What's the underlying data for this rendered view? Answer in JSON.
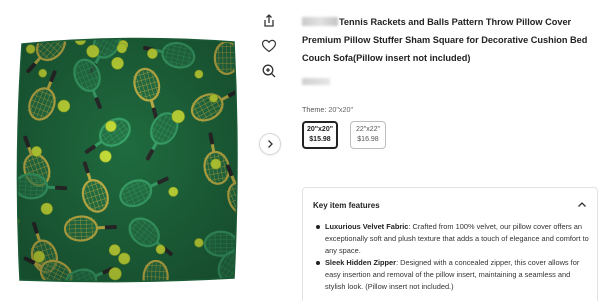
{
  "product": {
    "title": "Tennis Rackets and Balls Pattern Throw Pillow Cover Premium Pillow Stuffer Sham Square for Decorative Cushion Bed Couch Sofa(Pillow insert not included)"
  },
  "gallery": {
    "icons": [
      "share-icon",
      "heart-icon",
      "zoom-in-icon",
      "chevron-right-icon"
    ],
    "colors": {
      "pillow_bg": "#1f6b3f",
      "racket_frame_a": "#c8b94a",
      "racket_frame_b": "#3aa46a",
      "ball": "#c9e33a",
      "handle": "#2a2a2a"
    }
  },
  "theme": {
    "label": "Theme:",
    "value": "20\"x20\"",
    "options": [
      {
        "size": "20\"x20\"",
        "price": "$15.98",
        "selected": true
      },
      {
        "size": "22\"x22\"",
        "price": "$16.98",
        "selected": false
      }
    ]
  },
  "features": {
    "heading": "Key item features",
    "items": [
      {
        "title": "Luxurious Velvet Fabric",
        "text": ": Crafted from 100% velvet, our pillow cover offers an exceptionally soft and plush texture that adds a touch of elegance and comfort to any space."
      },
      {
        "title": "Sleek Hidden Zipper",
        "text": ": Designed with a concealed zipper, this cover allows for easy insertion and removal of the pillow insert, maintaining a seamless and stylish look. (Pillow insert not included.)"
      }
    ]
  }
}
